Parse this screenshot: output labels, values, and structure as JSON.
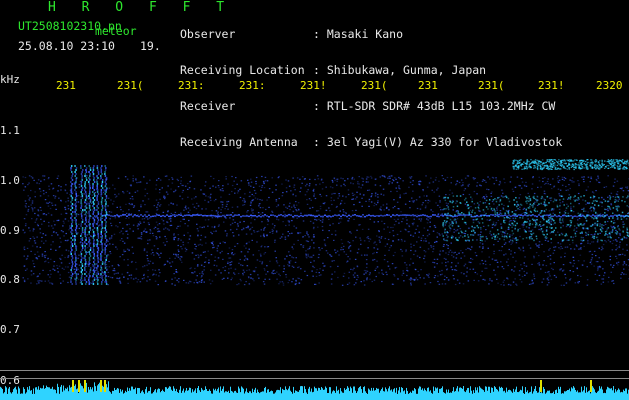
{
  "header": {
    "app_title": "H R O F F T",
    "file_name": "UT2508102310.pn",
    "meteor_label": "meteor",
    "date_time": "25.08.10 23:10",
    "counter": "19."
  },
  "info": [
    {
      "label": "Observer",
      "value": ": Masaki Kano"
    },
    {
      "label": "Receiving Location",
      "value": ": Shibukawa, Gunma, Japan"
    },
    {
      "label": "Receiver",
      "value": ": RTL-SDR SDR# 43dB L15 103.2MHz CW"
    },
    {
      "label": "Receiving Antenna",
      "value": ": 3el Yagi(V) Az 330 for Vladivostok"
    }
  ],
  "axis": {
    "unit": "kHz",
    "time_ticks": [
      "231",
      "231(",
      "231:",
      "231:",
      "231!",
      "231(",
      "231",
      "231(",
      "231!",
      "2320"
    ],
    "freq_ticks": [
      "1.1",
      "1.0",
      "0.9",
      "0.8",
      "0.7",
      "0.6"
    ]
  },
  "colors": {
    "background": "#000000",
    "label_green": "#2ee82e",
    "label_yellow": "#f2f200",
    "signal_blue": "#3a5cff",
    "signal_cyan": "#2fd3ff"
  }
}
